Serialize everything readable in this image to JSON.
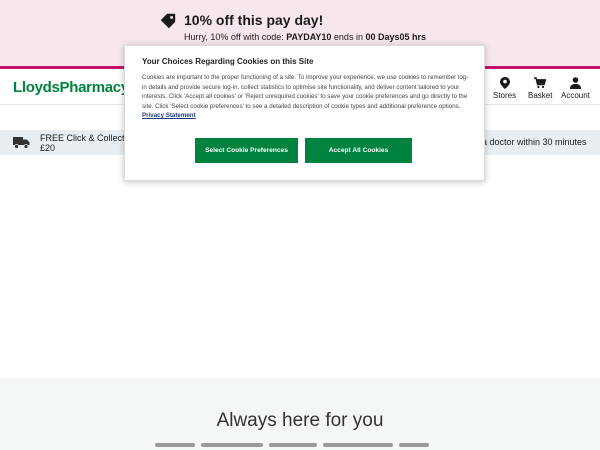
{
  "promo": {
    "title": "10% off this pay day!",
    "sub_prefix": "Hurry, 10% off with code: ",
    "code": "PAYDAY10",
    "sub_mid": " ends in ",
    "countdown": "00 Days05 hrs",
    "icon": "tag-icon"
  },
  "header": {
    "logo_part1": "Lloyds",
    "logo_part2": "Pharmacy",
    "stores_label": "Stores",
    "basket_label": "Basket",
    "account_label": "Account"
  },
  "strip": {
    "left_line1": "FREE Click & Collect o",
    "left_line2": "£20",
    "right_text": "a doctor within 30 minutes"
  },
  "footer": {
    "heading": "Always here for you"
  },
  "cookie_modal": {
    "title": "Your Choices Regarding Cookies on this Site",
    "body": "Cookies are important to the proper functioning of a site. To improve your experience, we use cookies to remember log-in details and provide secure log-in, collect statistics to optimise site functionality, and deliver content tailored to your interests. Click 'Accept all cookies' or 'Reject unrequired cookies' to save your cookie preferences and go directly to the site. Click 'Select cookie preferences' to see a detailed description of cookie types and additional preference options.",
    "link_text": "Privacy Statement",
    "prefs_button": "Select Cookie Preferences",
    "accept_button": "Accept All Cookies"
  },
  "colors": {
    "brand_green": "#00833e",
    "promo_bg": "#f8e6ee",
    "promo_line": "#c4136b",
    "strip_bg": "#e8eef2"
  }
}
